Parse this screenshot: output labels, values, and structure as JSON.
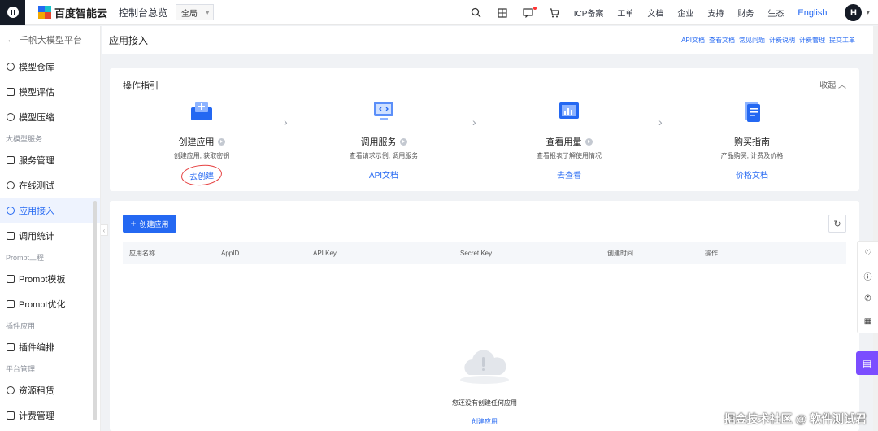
{
  "topbar": {
    "brand": "百度智能云",
    "console": "控制台总览",
    "scope": "全局",
    "links": [
      "ICP备案",
      "工单",
      "文档",
      "企业",
      "支持",
      "财务",
      "生态"
    ],
    "lang": "English",
    "avatar": "H",
    "icons": [
      "search-icon",
      "apps-icon",
      "message-icon",
      "cart-icon"
    ]
  },
  "sidebar": {
    "back": "千帆大模型平台",
    "items_top": [
      {
        "label": "模型仓库",
        "icon": "model-repo-icon"
      },
      {
        "label": "模型评估",
        "icon": "evaluate-icon"
      },
      {
        "label": "模型压缩",
        "icon": "compress-icon"
      }
    ],
    "group1": "大模型服务",
    "items_service": [
      {
        "label": "服务管理",
        "icon": "service-icon"
      },
      {
        "label": "在线测试",
        "icon": "test-icon"
      },
      {
        "label": "应用接入",
        "icon": "app-access-icon"
      },
      {
        "label": "调用统计",
        "icon": "stats-icon"
      }
    ],
    "group2": "Prompt工程",
    "items_prompt": [
      {
        "label": "Prompt模板",
        "icon": "template-icon"
      },
      {
        "label": "Prompt优化",
        "icon": "optimize-icon"
      }
    ],
    "group3": "插件应用",
    "items_plugin": [
      {
        "label": "插件编排",
        "icon": "plugin-icon"
      }
    ],
    "group4": "平台管理",
    "items_platform": [
      {
        "label": "资源租赁",
        "icon": "resource-icon"
      },
      {
        "label": "计费管理",
        "icon": "billing-icon"
      }
    ],
    "active": "应用接入"
  },
  "page": {
    "title": "应用接入",
    "doc_links": [
      "API文档",
      "查看文档",
      "常见问题",
      "计费说明",
      "计费管理",
      "提交工单"
    ]
  },
  "guide": {
    "title": "操作指引",
    "collapse": "收起",
    "steps": [
      {
        "name": "创建应用",
        "desc": "创建应用, 获取密钥",
        "action": "去创建"
      },
      {
        "name": "调用服务",
        "desc": "查看请求示例, 调用服务",
        "action": "API文档"
      },
      {
        "name": "查看用量",
        "desc": "查看报表了解使用情况",
        "action": "去查看"
      },
      {
        "name": "购买指南",
        "desc": "产品购买, 计费及价格",
        "action": "价格文档"
      }
    ]
  },
  "table": {
    "create_button": "创建应用",
    "columns": [
      "应用名称",
      "AppID",
      "API Key",
      "Secret Key",
      "创建时间",
      "操作"
    ],
    "empty_text": "您还没有创建任何应用",
    "empty_link": "创建应用"
  },
  "watermark": "掘金技术社区 @ 软件测试君",
  "colors": {
    "accent": "#2468f2",
    "chat": "#7b4dff",
    "topbar_dark": "#151b26"
  }
}
